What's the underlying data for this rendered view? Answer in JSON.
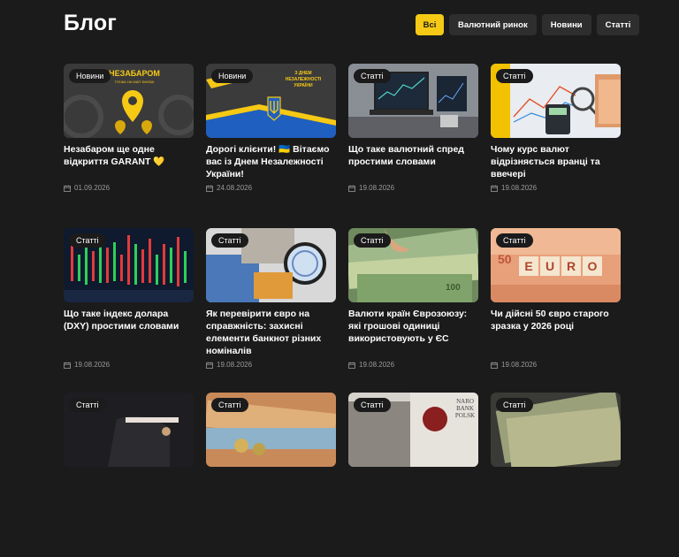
{
  "page": {
    "title": "Блог"
  },
  "filters": [
    {
      "label": "Всі",
      "active": true
    },
    {
      "label": "Валютний ринок",
      "active": false
    },
    {
      "label": "Новини",
      "active": false
    },
    {
      "label": "Статті",
      "active": false
    }
  ],
  "posts": [
    {
      "badge": "Новини",
      "title": "Незабаром ще одне відкриття GARANT 💛",
      "date": "01.09.2026",
      "image": "garant-map-pin",
      "image_text": "НЕЗАБАРОМ",
      "image_subtext": "ТОЧКА НА МАП ФИЄВА"
    },
    {
      "badge": "Новини",
      "title": "Дорогі клієнти! 🇺🇦 Вітаємо вас із Днем Незалежності України!",
      "date": "24.08.2026",
      "image": "ukraine-trident",
      "image_text": "З ДНЕМ НЕЗАЛЕЖНОСТІ УКРАЇНИ"
    },
    {
      "badge": "Статті",
      "title": "Що таке валютний спред простими словами",
      "date": "19.08.2026",
      "image": "laptop-chart"
    },
    {
      "badge": "Статті",
      "title": "Чому курс валют відрізняється вранці та ввечері",
      "date": "19.08.2026",
      "image": "chart-calculator"
    },
    {
      "badge": "Статті",
      "title": "Що таке індекс долара (DXY) простими словами",
      "date": "19.08.2026",
      "image": "candlestick-chart"
    },
    {
      "badge": "Статті",
      "title": "Як перевірити євро на справжність: захисні елементи банкнот різних номіналів",
      "date": "19.08.2026",
      "image": "magnifier-euro"
    },
    {
      "badge": "Статті",
      "title": "Валюти країн Єврозоюзу: які грошові одиниці використовують у ЄС",
      "date": "19.08.2026",
      "image": "euro-banknotes"
    },
    {
      "badge": "Статті",
      "title": "Чи дійсні 50 євро старого зразка у 2026 році",
      "date": "19.08.2026",
      "image": "euro-blocks",
      "image_text": "EURO",
      "image_subtext": "50"
    },
    {
      "badge": "Статті",
      "title": "",
      "date": "",
      "image": "phone-hand"
    },
    {
      "badge": "Статті",
      "title": "",
      "date": "",
      "image": "banknotes-coins"
    },
    {
      "badge": "Статті",
      "title": "",
      "date": "",
      "image": "polish-zloty",
      "image_text": "NARO BANK POLSK"
    },
    {
      "badge": "Статті",
      "title": "",
      "date": "",
      "image": "money-stack"
    }
  ],
  "colors": {
    "accent": "#f6c915",
    "background": "#1b1b1b",
    "chip": "#2e2e2e"
  }
}
